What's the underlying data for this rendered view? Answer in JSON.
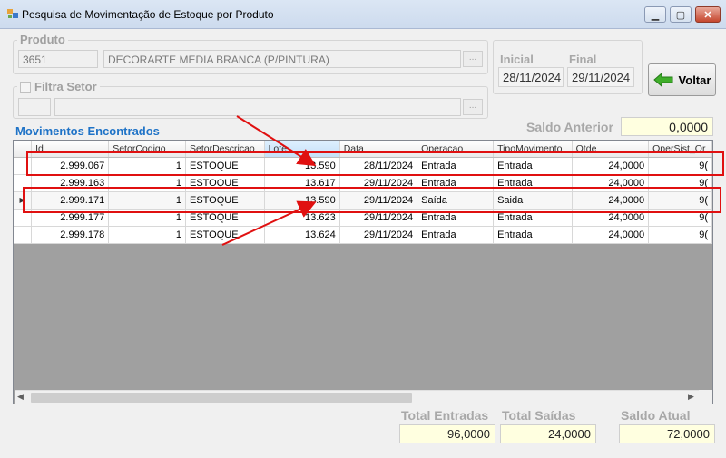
{
  "window": {
    "title": "Pesquisa de Movimentação de Estoque por Produto"
  },
  "produto": {
    "label": "Produto",
    "code": "3651",
    "description": "DECORARTE MEDIA BRANCA (P/PINTURA)",
    "lookup_button": "..."
  },
  "setor": {
    "checkbox_label": "Filtra Setor",
    "lookup_button": "..."
  },
  "dates": {
    "inicial_label": "Inicial",
    "final_label": "Final",
    "inicial": "28/11/2024",
    "final": "29/11/2024"
  },
  "voltar_label": "Voltar",
  "section_title": "Movimentos Encontrados",
  "saldo_anterior": {
    "label": "Saldo Anterior",
    "value": "0,0000"
  },
  "grid": {
    "columns": [
      "Id",
      "SetorCodigo",
      "SetorDescricao",
      "Lote",
      "Data",
      "Operacao",
      "TipoMovimento",
      "Qtde",
      "OperSist_Or"
    ],
    "rows": [
      [
        "2.999.067",
        "1",
        "ESTOQUE",
        "13.590",
        "28/11/2024",
        "Entrada",
        "Entrada",
        "24,0000",
        "9("
      ],
      [
        "2.999.163",
        "1",
        "ESTOQUE",
        "13.617",
        "29/11/2024",
        "Entrada",
        "Entrada",
        "24,0000",
        "9("
      ],
      [
        "2.999.171",
        "1",
        "ESTOQUE",
        "13.590",
        "29/11/2024",
        "Saída",
        "Saida",
        "24,0000",
        "9("
      ],
      [
        "2.999.177",
        "1",
        "ESTOQUE",
        "13.623",
        "29/11/2024",
        "Entrada",
        "Entrada",
        "24,0000",
        "9("
      ],
      [
        "2.999.178",
        "1",
        "ESTOQUE",
        "13.624",
        "29/11/2024",
        "Entrada",
        "Entrada",
        "24,0000",
        "9("
      ]
    ],
    "current_row_marker": "▶"
  },
  "totals": {
    "entradas_label": "Total Entradas",
    "entradas": "96,0000",
    "saidas_label": "Total Saídas",
    "saidas": "24,0000",
    "saldo_label": "Saldo Atual",
    "saldo": "72,0000"
  },
  "colors": {
    "annotation_red": "#e01010",
    "section_blue": "#1f73c7",
    "value_box": "#ffffe0"
  }
}
